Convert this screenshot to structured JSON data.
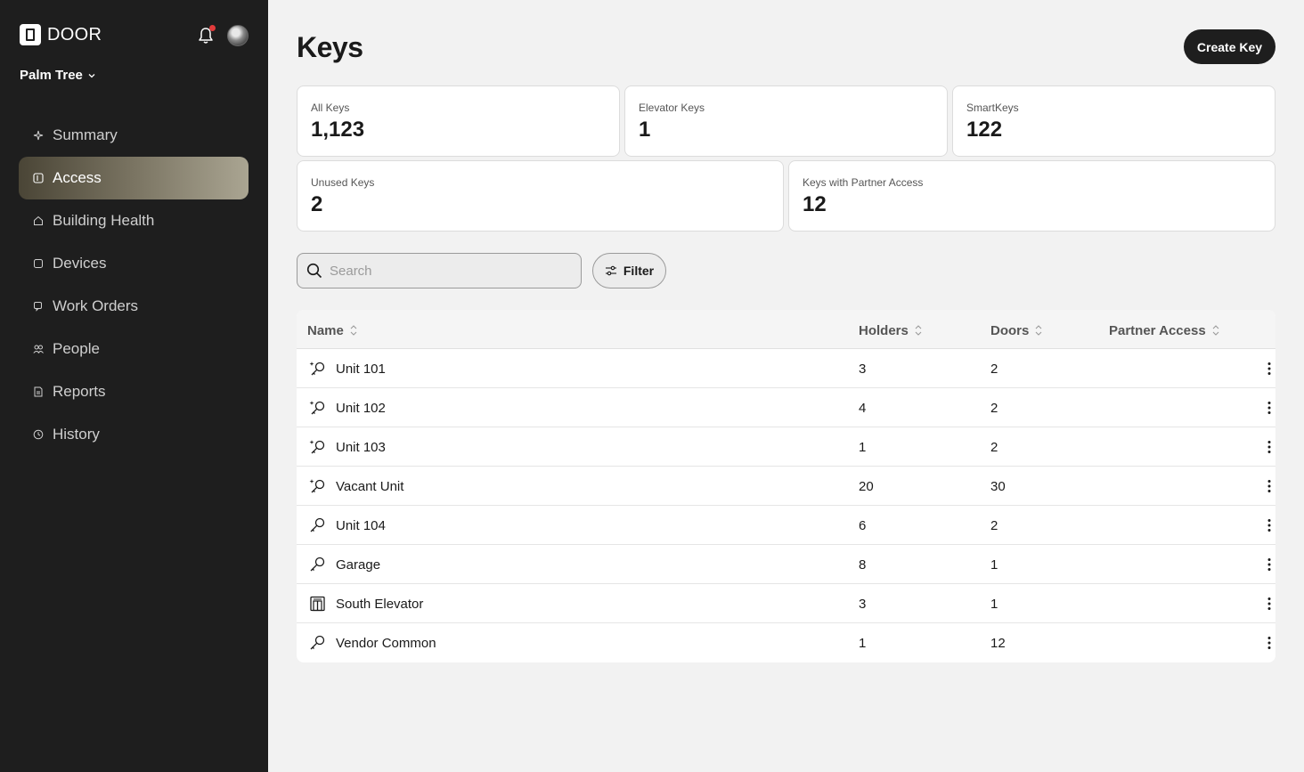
{
  "brand": {
    "name": "DOOR"
  },
  "property": {
    "name": "Palm Tree"
  },
  "nav": {
    "items": [
      {
        "label": "Summary",
        "icon": "sparkle-icon"
      },
      {
        "label": "Access",
        "icon": "access-icon",
        "active": true
      },
      {
        "label": "Building Health",
        "icon": "house-heart-icon"
      },
      {
        "label": "Devices",
        "icon": "device-icon"
      },
      {
        "label": "Work Orders",
        "icon": "work-order-icon"
      },
      {
        "label": "People",
        "icon": "people-icon"
      },
      {
        "label": "Reports",
        "icon": "report-icon"
      },
      {
        "label": "History",
        "icon": "clock-icon"
      }
    ]
  },
  "header": {
    "title": "Keys",
    "create_label": "Create Key"
  },
  "stats": {
    "all_keys": {
      "label": "All Keys",
      "value": "1,123"
    },
    "elevator_keys": {
      "label": "Elevator Keys",
      "value": "1"
    },
    "smart_keys": {
      "label": "SmartKeys",
      "value": "122"
    },
    "unused_keys": {
      "label": "Unused Keys",
      "value": "2"
    },
    "partner_keys": {
      "label": "Keys with Partner Access",
      "value": "12"
    }
  },
  "search": {
    "placeholder": "Search",
    "value": ""
  },
  "filter": {
    "label": "Filter"
  },
  "table": {
    "columns": [
      "Name",
      "Holders",
      "Doors",
      "Partner Access"
    ],
    "rows": [
      {
        "icon": "smart-key-icon",
        "name": "Unit 101",
        "holders": "3",
        "doors": "2",
        "partner": ""
      },
      {
        "icon": "smart-key-icon",
        "name": "Unit 102",
        "holders": "4",
        "doors": "2",
        "partner": ""
      },
      {
        "icon": "smart-key-icon",
        "name": "Unit 103",
        "holders": "1",
        "doors": "2",
        "partner": ""
      },
      {
        "icon": "smart-key-icon",
        "name": "Vacant Unit",
        "holders": "20",
        "doors": "30",
        "partner": ""
      },
      {
        "icon": "key-icon",
        "name": "Unit 104",
        "holders": "6",
        "doors": "2",
        "partner": ""
      },
      {
        "icon": "key-icon",
        "name": "Garage",
        "holders": "8",
        "doors": "1",
        "partner": ""
      },
      {
        "icon": "elevator-icon",
        "name": "South Elevator",
        "holders": "3",
        "doors": "1",
        "partner": ""
      },
      {
        "icon": "key-icon",
        "name": "Vendor Common",
        "holders": "1",
        "doors": "12",
        "partner": ""
      }
    ]
  },
  "colors": {
    "sidebar": "#1e1e1e",
    "accent": "#1e1e1e",
    "notification": "#e23b3b"
  }
}
